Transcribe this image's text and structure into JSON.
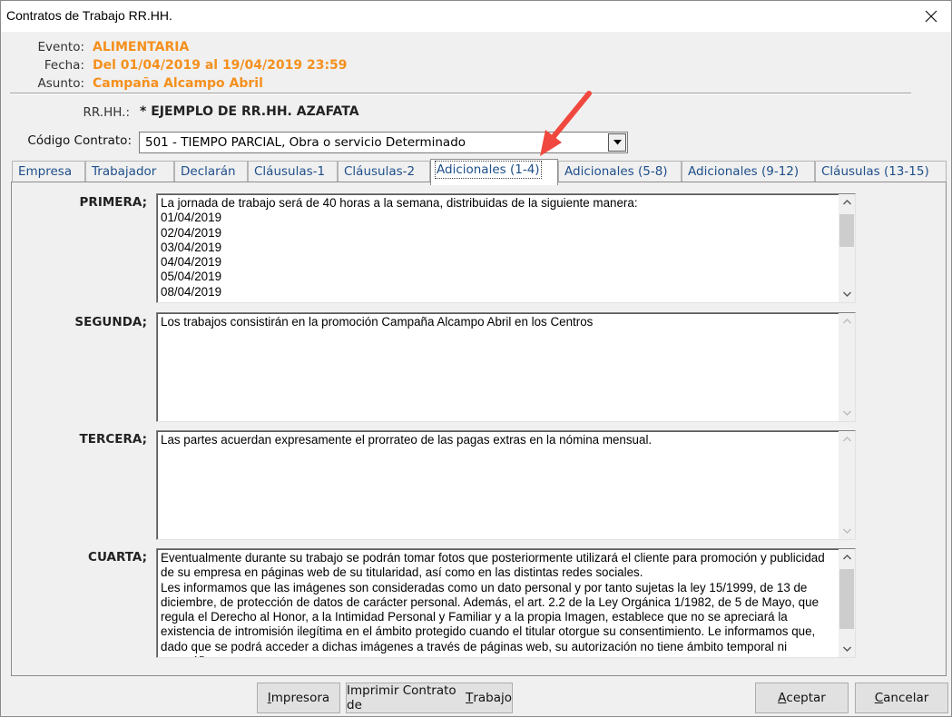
{
  "window": {
    "title": "Contratos de Trabajo RR.HH."
  },
  "header": {
    "evento_label": "Evento:",
    "evento_value": "ALIMENTARIA",
    "fecha_label": "Fecha:",
    "fecha_value": "Del 01/04/2019 al 19/04/2019 23:59",
    "asunto_label": "Asunto:",
    "asunto_value": "Campaña Alcampo Abril",
    "rrhh_label": "RR.HH.:",
    "rrhh_value": "* EJEMPLO DE RR.HH. AZAFATA",
    "accent_color": "#f5901e"
  },
  "codigo": {
    "label": "Código Contrato:",
    "selected": "501 - TIEMPO PARCIAL, Obra o servicio Determinado"
  },
  "tabs": [
    {
      "label": "Empresa"
    },
    {
      "label": "Trabajador"
    },
    {
      "label": "Declarán"
    },
    {
      "label": "Cláusulas-1"
    },
    {
      "label": "Cláusulas-2"
    },
    {
      "label": "Adicionales (1-4)",
      "active": true
    },
    {
      "label": "Adicionales (5-8)"
    },
    {
      "label": "Adicionales (9-12)"
    },
    {
      "label": "Cláusulas (13-15)"
    }
  ],
  "clauses": {
    "primera": {
      "label": "PRIMERA;",
      "text": "La jornada de trabajo será de 40 horas a la semana, distribuidas de la siguiente manera:\n01/04/2019\n02/04/2019\n03/04/2019\n04/04/2019\n05/04/2019\n08/04/2019"
    },
    "segunda": {
      "label": "SEGUNDA;",
      "text": "Los trabajos consistirán en la promoción Campaña Alcampo Abril en los Centros"
    },
    "tercera": {
      "label": "TERCERA;",
      "text": "Las partes acuerdan expresamente el prorrateo de las pagas extras en la nómina mensual."
    },
    "cuarta": {
      "label": "CUARTA;",
      "text": "Eventualmente durante su trabajo se podrán tomar fotos que posteriormente utilizará el cliente para promoción y publicidad de su empresa en páginas web de su titularidad, así como en las distintas redes sociales.\nLes informamos que las imágenes son consideradas como un dato personal y por tanto sujetas la ley 15/1999, de 13 de diciembre, de protección de datos de carácter personal. Además, el art. 2.2 de la Ley Orgánica 1/1982, de 5 de Mayo, que regula el Derecho al Honor, a la Intimidad Personal y Familiar y a la propia Imagen, establece que no se apreciará la existencia de intromisión ilegítima en el ámbito protegido cuando el titular otorgue su consentimiento. Le informamos que, dado que se podrá acceder a dichas imágenes a través de páginas web, su autorización no tiene ámbito temporal ni geográfico"
    }
  },
  "buttons": {
    "impresora": {
      "before": "",
      "mnemonic": "I",
      "after": "mpresora"
    },
    "imprimir": {
      "before": "Imprimir Contrato de ",
      "mnemonic": "T",
      "after": "rabajo"
    },
    "aceptar": {
      "before": "",
      "mnemonic": "A",
      "after": "ceptar"
    },
    "cancelar": {
      "before": "",
      "mnemonic": "C",
      "after": "ancelar"
    }
  },
  "annotation": {
    "arrow_color": "#f0483e",
    "icon": "red-arrow-icon"
  }
}
